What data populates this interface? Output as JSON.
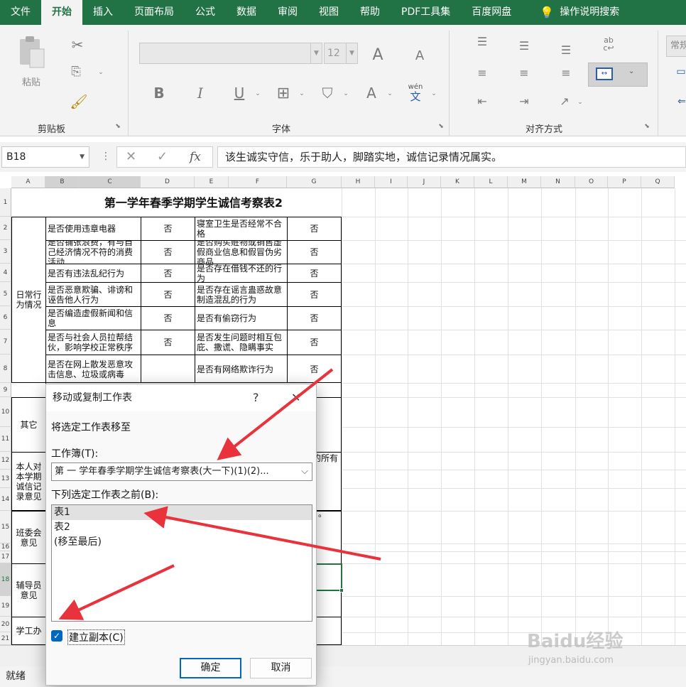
{
  "menubar": {
    "tabs": [
      "文件",
      "开始",
      "插入",
      "页面布局",
      "公式",
      "数据",
      "审阅",
      "视图",
      "帮助",
      "PDF工具集",
      "百度网盘"
    ],
    "active_index": 1,
    "help_label": "操作说明搜索",
    "bg_color": "#217346"
  },
  "ribbon": {
    "clipboard": {
      "label": "剪贴板",
      "paste_label": "粘贴"
    },
    "font": {
      "label": "字体",
      "font_size": "12",
      "wen_label": "wén",
      "wen_char": "文",
      "bold": "B",
      "italic": "I",
      "underline": "U",
      "font_color": "A",
      "grow": "A",
      "shrink": "A"
    },
    "alignment": {
      "label": "对齐方式"
    },
    "number": {
      "label": "常规"
    }
  },
  "formula_bar": {
    "name_box": "B18",
    "fx": "fx",
    "content": "该生诚实守信，乐于助人，脚踏实地，诚信记录情况属实。"
  },
  "grid": {
    "columns": [
      "A",
      "B",
      "C",
      "D",
      "E",
      "F",
      "G",
      "H",
      "I",
      "J",
      "K",
      "L",
      "M",
      "N",
      "O",
      "P",
      "Q"
    ],
    "rows": [
      "1",
      "2",
      "3",
      "4",
      "5",
      "6",
      "7",
      "8",
      "9",
      "10",
      "11",
      "12",
      "13",
      "14",
      "15",
      "16",
      "17",
      "18",
      "19",
      "20",
      "21"
    ],
    "selected_row": "18",
    "title": "第一学年春季学期学生诚信考察表2",
    "section_daily": "日常行为情况",
    "section_other": "其它",
    "section_self": "本人对本学期诚信记录意见",
    "section_class": "班委会意见",
    "section_advisor": "辅导员意见",
    "section_office": "学工办",
    "items_left": [
      "是否使用违章电器",
      "是否铺张浪费，有与自己经济情况不符的消费活动",
      "是否有违法乱纪行为",
      "是否恶意欺骗、诽谤和诬告他人行为",
      "是否编造虚假新闻和信息",
      "是否与社会人员拉帮结伙，影响学校正常秩序",
      "是否在网上散发恶意攻击信息、垃圾或病毒"
    ],
    "answers_left": [
      "否",
      "否",
      "否",
      "否",
      "否",
      "否",
      ""
    ],
    "items_right": [
      "寝室卫生是否经常不合格",
      "是否购买赃物或销售虚假商业信息和假冒伪劣商品",
      "是否存在借钱不还的行为",
      "是否存在谣言蛊惑故意制造混乱的行为",
      "是否有偷窃行为",
      "是否发生问题时相互包庇、撒谎、隐瞒事实",
      "是否有网络欺诈行为"
    ],
    "answers_right": [
      "否",
      "否",
      "否",
      "否",
      "否",
      "否",
      "否"
    ],
    "partial_g12": "的所有",
    "partial_g15": "。"
  },
  "dialog": {
    "title": "移动或复制工作表",
    "help": "?",
    "close": "✕",
    "move_to_label": "将选定工作表移至",
    "workbook_label": "工作簿(T):",
    "workbook_value": "第 一 学年春季学期学生诚信考察表(大一下)(1)(2)...",
    "before_label": "下列选定工作表之前(B):",
    "sheets": [
      "表1",
      "表2",
      "(移至最后)"
    ],
    "selected_sheet_index": 0,
    "copy_label": "建立副本(C)",
    "copy_checked": true,
    "ok": "确定",
    "cancel": "取消"
  },
  "status": {
    "text": "就绪"
  },
  "watermark": {
    "brand": "Baidu经验",
    "url": "jingyan.baidu.com"
  },
  "colors": {
    "accent": "#217346",
    "arrow": "#e8323c",
    "checkbox": "#0067c0"
  }
}
